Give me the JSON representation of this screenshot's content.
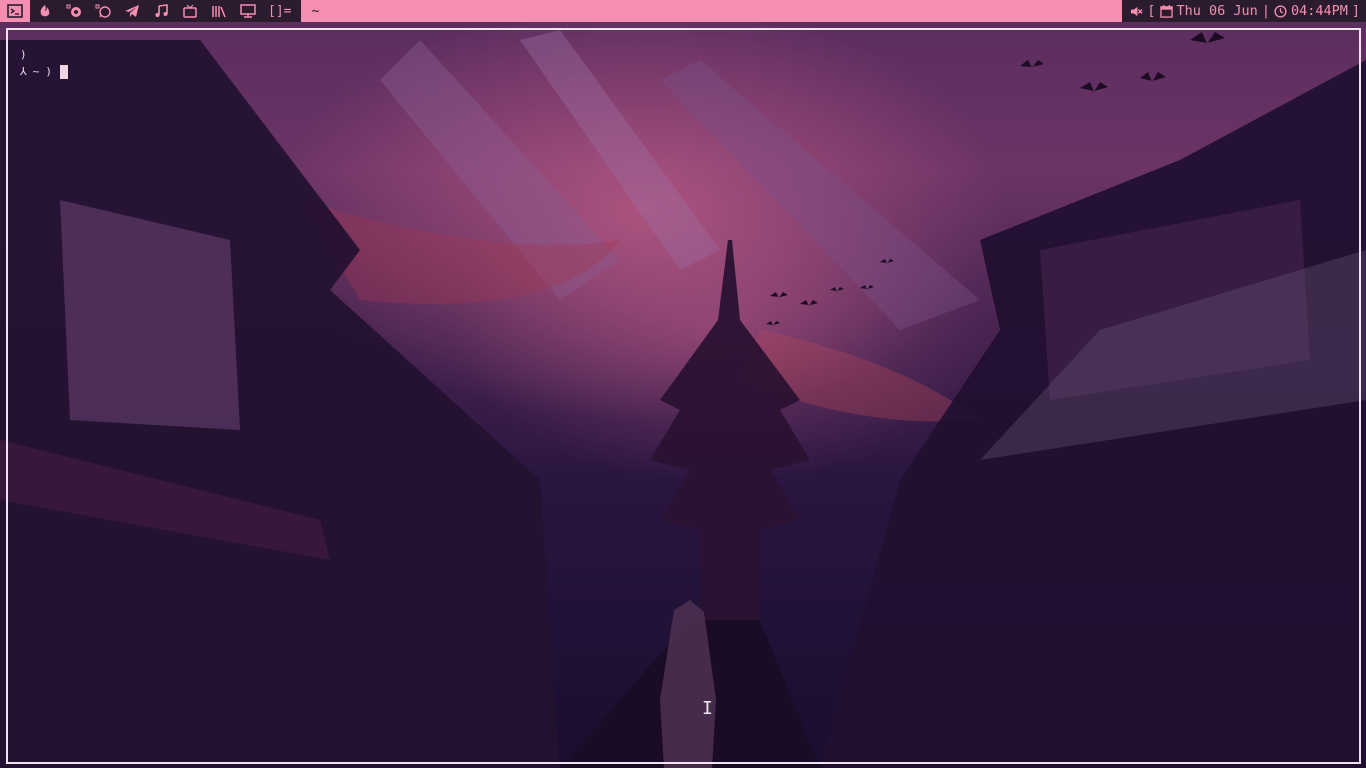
{
  "topbar": {
    "workspaces": [
      {
        "icon": "terminal-icon",
        "active": true
      },
      {
        "icon": "firefox-icon",
        "active": false
      },
      {
        "icon": "file-manager-icon",
        "active": false
      },
      {
        "icon": "whatsapp-icon",
        "active": false
      },
      {
        "icon": "telegram-icon",
        "active": false
      },
      {
        "icon": "music-note-icon",
        "active": false
      },
      {
        "icon": "tv-icon",
        "active": false
      },
      {
        "icon": "library-icon",
        "active": false
      },
      {
        "icon": "monitor-icon",
        "active": false
      }
    ],
    "layout_symbol": "[]=",
    "window_title": "~",
    "status": {
      "volume_icon": "volume-muted-icon",
      "bracket_open": "[",
      "date": "Thu 06 Jun",
      "separator": "|",
      "time": "04:44PM",
      "bracket_close": "]"
    },
    "colors": {
      "accent": "#f48fb1",
      "dark": "#2b1b2e"
    }
  },
  "terminal": {
    "line1": ")",
    "prompt_symbol": "⅄",
    "prompt_dir": "~",
    "prompt_arrow": ")"
  }
}
